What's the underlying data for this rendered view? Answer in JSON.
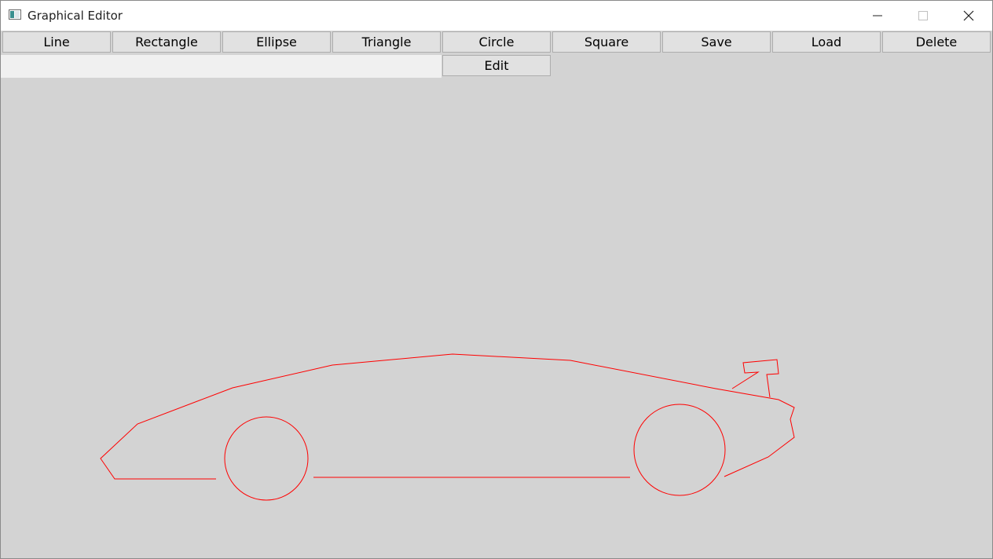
{
  "window": {
    "title": "Graphical Editor",
    "controls": [
      "minimize",
      "maximize",
      "close"
    ]
  },
  "toolbar": {
    "buttons": [
      "Line",
      "Rectangle",
      "Ellipse",
      "Triangle",
      "Circle",
      "Square",
      "Save",
      "Load",
      "Delete"
    ],
    "edit_label": "Edit"
  },
  "canvas": {
    "background": "#d3d3d3",
    "stroke_color": "#ff0000",
    "drawing": "car outline: body polyline, two wheel circles, spoiler"
  }
}
